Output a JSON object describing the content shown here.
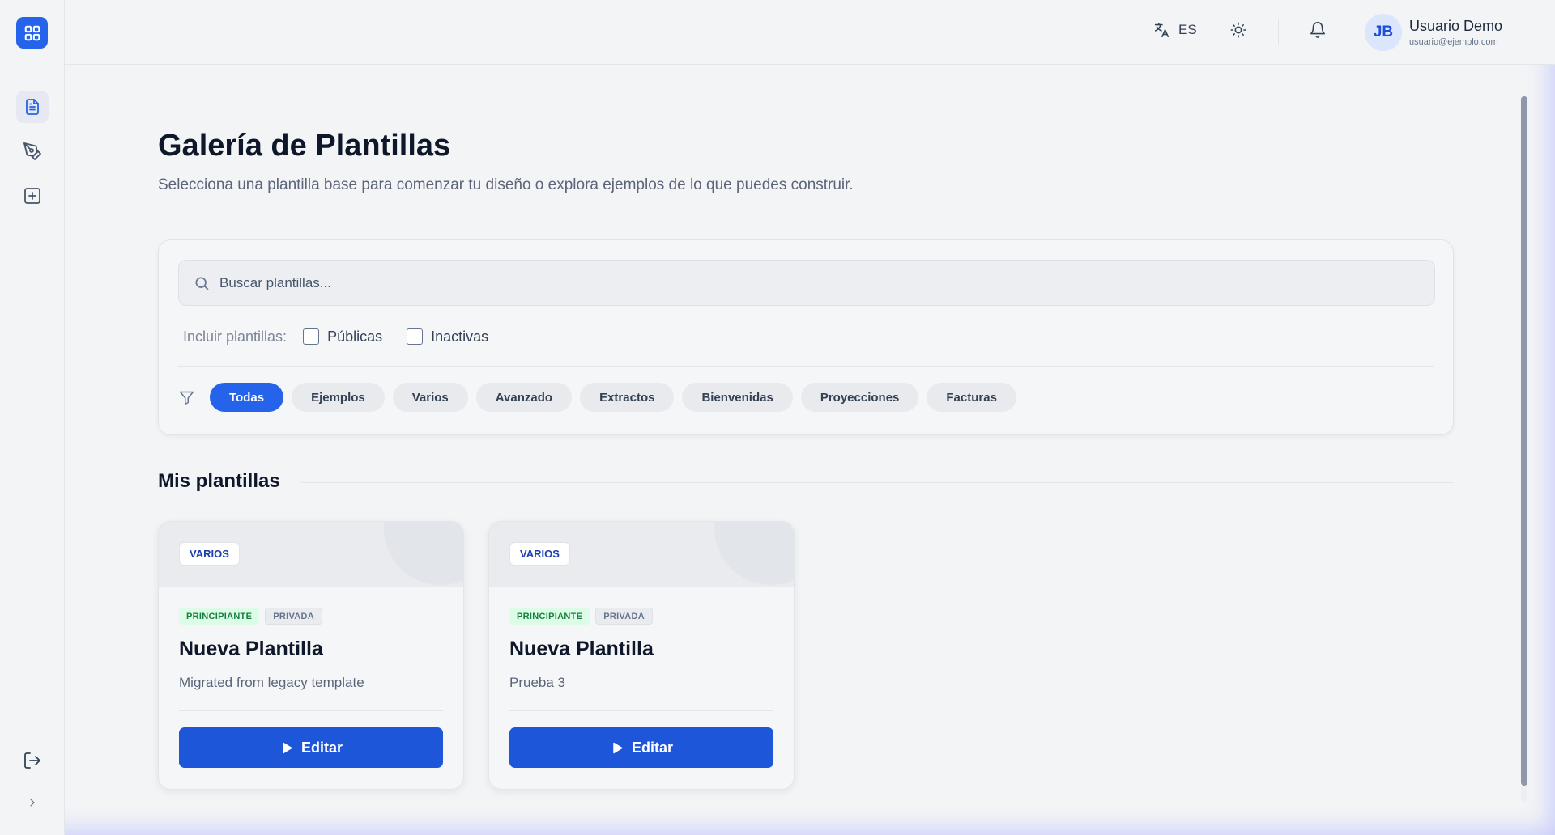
{
  "header": {
    "language": "ES",
    "user": {
      "initials": "JB",
      "name": "Usuario Demo",
      "email": "usuario@ejemplo.com"
    }
  },
  "page": {
    "title": "Galería de Plantillas",
    "subtitle": "Selecciona una plantilla base para comenzar tu diseño o explora ejemplos de lo que puedes construir."
  },
  "search": {
    "placeholder": "Buscar plantillas...",
    "value": ""
  },
  "include": {
    "label": "Incluir plantillas:",
    "options": [
      {
        "label": "Públicas",
        "checked": false
      },
      {
        "label": "Inactivas",
        "checked": false
      }
    ]
  },
  "categories": [
    "Todas",
    "Ejemplos",
    "Varios",
    "Avanzado",
    "Extractos",
    "Bienvenidas",
    "Proyecciones",
    "Facturas"
  ],
  "active_category": "Todas",
  "section": {
    "title": "Mis plantillas"
  },
  "templates": [
    {
      "category": "VARIOS",
      "level": "PRINCIPIANTE",
      "visibility": "PRIVADA",
      "title": "Nueva Plantilla",
      "description": "Migrated from legacy template",
      "button": "Editar"
    },
    {
      "category": "VARIOS",
      "level": "PRINCIPIANTE",
      "visibility": "PRIVADA",
      "title": "Nueva Plantilla",
      "description": "Prueba 3",
      "button": "Editar"
    }
  ],
  "colors": {
    "accent": "#2563eb",
    "level_bg": "#dcfce7",
    "level_text": "#15803d"
  }
}
